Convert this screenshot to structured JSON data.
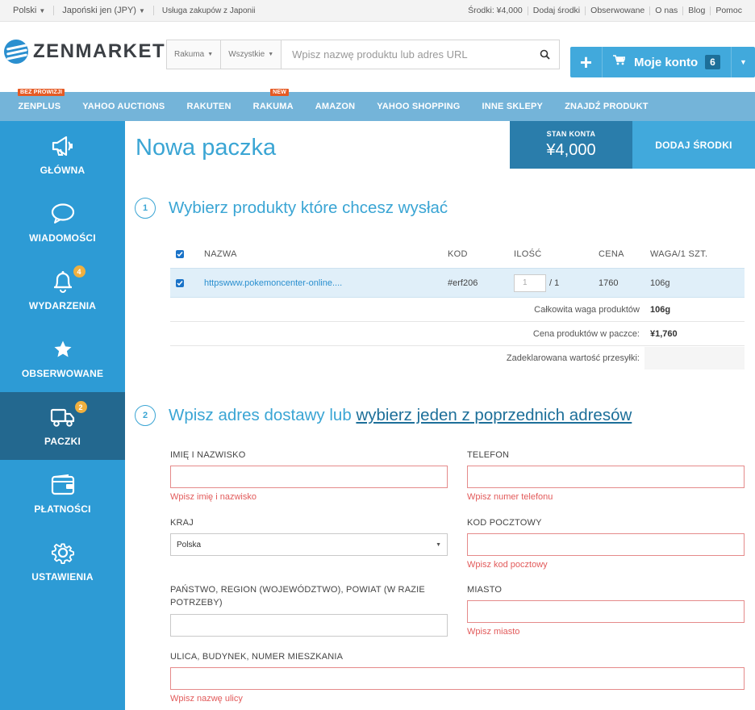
{
  "topbar": {
    "language": "Polski",
    "currency": "Japoński jen (JPY)",
    "service": "Usługa zakupów z Japonii",
    "links": [
      "Środki: ¥4,000",
      "Dodaj środki",
      "Obserwowane",
      "O nas",
      "Blog",
      "Pomoc"
    ]
  },
  "header": {
    "logo": "ZENMARKET",
    "store_select": "Rakuma",
    "category_select": "Wszystkie",
    "search_placeholder": "Wpisz nazwę produktu lub adres URL",
    "account_label": "Moje konto",
    "account_badge": "6"
  },
  "nav": {
    "items": [
      {
        "label": "ZENPLUS",
        "tag": "BEZ PROWIZJI"
      },
      {
        "label": "YAHOO AUCTIONS",
        "tag": ""
      },
      {
        "label": "RAKUTEN",
        "tag": ""
      },
      {
        "label": "RAKUMA",
        "tag": "NEW"
      },
      {
        "label": "AMAZON",
        "tag": ""
      },
      {
        "label": "YAHOO SHOPPING",
        "tag": ""
      },
      {
        "label": "INNE SKLEPY",
        "tag": ""
      },
      {
        "label": "ZNAJDŹ PRODUKT",
        "tag": ""
      }
    ]
  },
  "sidebar": {
    "items": [
      {
        "label": "GŁÓWNA",
        "icon": "megaphone-icon",
        "badge": ""
      },
      {
        "label": "WIADOMOŚCI",
        "icon": "chat-bubble-icon",
        "badge": ""
      },
      {
        "label": "WYDARZENIA",
        "icon": "bell-icon",
        "badge": "4"
      },
      {
        "label": "OBSERWOWANE",
        "icon": "star-icon",
        "badge": ""
      },
      {
        "label": "PACZKI",
        "icon": "truck-icon",
        "badge": "2"
      },
      {
        "label": "PŁATNOŚCI",
        "icon": "wallet-icon",
        "badge": ""
      },
      {
        "label": "USTAWIENIA",
        "icon": "gear-icon",
        "badge": ""
      }
    ]
  },
  "page": {
    "title": "Nowa paczka",
    "balance_label": "STAN KONTA",
    "balance_value": "¥4,000",
    "add_funds": "DODAJ ŚRODKI"
  },
  "step1": {
    "number": "1",
    "title": "Wybierz produkty które chcesz wysłać",
    "headers": {
      "name": "NAZWA",
      "code": "KOD",
      "qty": "ILOŚĆ",
      "price": "CENA",
      "weight": "WAGA/1 SZT."
    },
    "product": {
      "name": "httpswww.pokemoncenter-online....",
      "code": "#erf206",
      "qty_value": "1",
      "qty_total": "/ 1",
      "price": "1760",
      "weight": "106g"
    },
    "summary": [
      {
        "label": "Całkowita waga produktów",
        "value": "106g"
      },
      {
        "label": "Cena produktów w paczce:",
        "value": "¥1,760"
      },
      {
        "label": "Zadeklarowana wartość przesyłki:",
        "value": ""
      }
    ]
  },
  "step2": {
    "number": "2",
    "title_prefix": "Wpisz adres dostawy lub ",
    "title_link": "wybierz jeden z poprzednich adresów",
    "fields": {
      "name_label": "IMIĘ I NAZWISKO",
      "name_error": "Wpisz imię i nazwisko",
      "phone_label": "TELEFON",
      "phone_error": "Wpisz numer telefonu",
      "country_label": "KRAJ",
      "country_value": "Polska",
      "zip_label": "KOD POCZTOWY",
      "zip_error": "Wpisz kod pocztowy",
      "region_label": "PAŃSTWO, REGION (WOJEWÓDZTWO), POWIAT (W RAZIE POTRZEBY)",
      "city_label": "MIASTO",
      "city_error": "Wpisz miasto",
      "street_label": "ULICA, BUDYNEK, NUMER MIESZKANIA",
      "street_error": "Wpisz nazwę ulicy"
    }
  },
  "colors": {
    "accent": "#3aa5d4",
    "sidebar": "#2d9bd5",
    "sidebar_active": "#23688f",
    "nav": "#74b4d9",
    "error": "#e25a5a",
    "badge": "#f0b03f",
    "tag": "#e55a24"
  }
}
